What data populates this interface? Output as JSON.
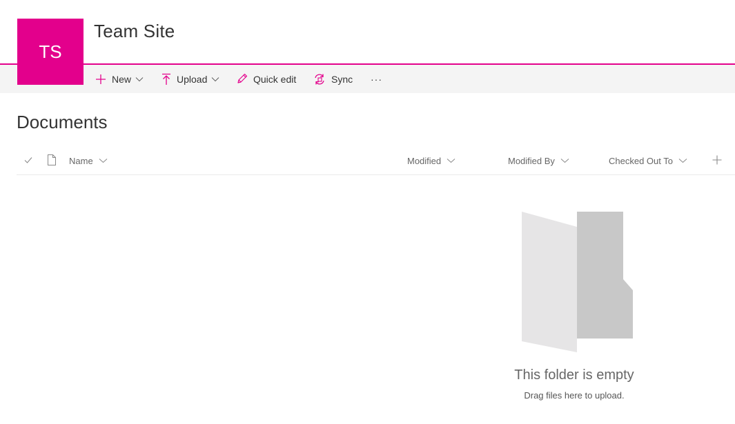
{
  "site": {
    "logo_text": "TS",
    "title": "Team Site",
    "accent_color": "#e3008c"
  },
  "command_bar": {
    "new_label": "New",
    "upload_label": "Upload",
    "quick_edit_label": "Quick edit",
    "sync_label": "Sync",
    "more_label": "···"
  },
  "library": {
    "title": "Documents",
    "columns": {
      "name": "Name",
      "modified": "Modified",
      "modified_by": "Modified By",
      "checked_out_to": "Checked Out To"
    }
  },
  "empty_state": {
    "title": "This folder is empty",
    "subtitle": "Drag files here to upload."
  },
  "icons": {
    "new": "plus-icon",
    "upload": "upload-icon",
    "quick_edit": "pencil-icon",
    "sync": "sync-icon",
    "more": "ellipsis-icon",
    "check": "checkmark-icon",
    "file_type": "document-icon",
    "add_column": "plus-icon",
    "dropdown": "chevron-down-icon",
    "empty": "folder-icon"
  }
}
